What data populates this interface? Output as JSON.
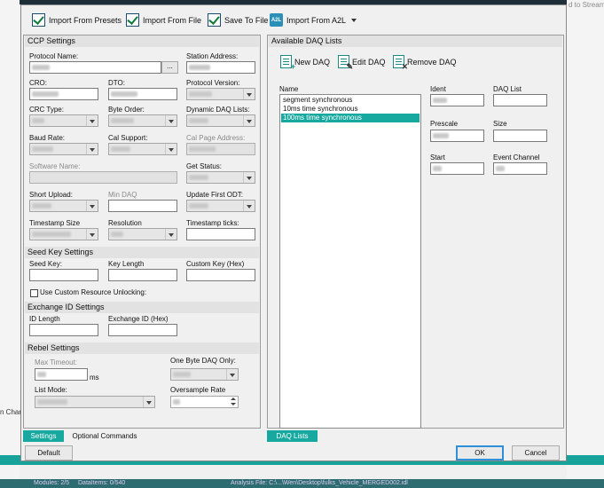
{
  "background": {
    "stream_text": "d to Stream",
    "channel_text": "n Chan",
    "status_modules": "Modules: 2/5",
    "status_dataitems": "DataItems: 0/540",
    "status_analysis": "Analysis File: C:\\...\\Wen\\Desktop\\fulks_Vehicle_MERGED002.idl"
  },
  "toolbar": {
    "import_presets": "Import From Presets",
    "import_file": "Import From File",
    "save_file": "Save To File",
    "a2l_icon_text": "A2L",
    "import_a2l": "Import From A2L"
  },
  "ccp": {
    "title": "CCP Settings",
    "protocol_name": "Protocol Name:",
    "ellipsis": "...",
    "station_address": "Station Address:",
    "cro": "CRO:",
    "dto": "DTO:",
    "protocol_version": "Protocol Version:",
    "crc_type": "CRC Type:",
    "byte_order": "Byte Order:",
    "dynamic_daq_lists": "Dynamic DAQ Lists:",
    "baud_rate": "Baud Rate:",
    "cal_support": "Cal Support:",
    "cal_page_address": "Cal Page Address:",
    "software_name": "Software Name:",
    "get_status": "Get Status:",
    "short_upload": "Short Upload:",
    "min_daq": "Min DAQ",
    "update_first_odt": "Update First ODT:",
    "timestamp_size": "Timestamp Size",
    "resolution": "Resolution",
    "timestamp_ticks": "Timestamp ticks:"
  },
  "seed": {
    "title": "Seed Key Settings",
    "seed_key": "Seed Key:",
    "key_length": "Key Length",
    "custom_key": "Custom Key (Hex)",
    "custom_unlock": "Use Custom Resource Unlocking:"
  },
  "exchange": {
    "title": "Exchange ID Settings",
    "id_length": "ID Length",
    "exchange_id": "Exchange ID (Hex)"
  },
  "rebel": {
    "title": "Rebel Settings",
    "max_timeout": "Max Timeout:",
    "ms": "ms",
    "one_byte_daq": "One Byte DAQ Only:",
    "list_mode": "List Mode:",
    "oversample_rate": "Oversample Rate"
  },
  "daq": {
    "title": "Available DAQ Lists",
    "new_daq": "New DAQ",
    "edit_daq": "Edit DAQ",
    "remove_daq": "Remove DAQ",
    "name_header": "Name",
    "items": [
      "segment synchronous",
      "10ms time synchronous",
      "100ms time synchronous"
    ],
    "selected_index": 2,
    "ident": "Ident",
    "daq_list": "DAQ List",
    "prescale": "Prescale",
    "size": "Size",
    "start": "Start",
    "event_channel": "Event Channel"
  },
  "tabs": {
    "settings": "Settings",
    "optional": "Optional Commands",
    "daq_lists": "DAQ Lists"
  },
  "buttons": {
    "default": "Default",
    "ok": "OK",
    "cancel": "Cancel"
  },
  "colors": {
    "accent": "#17a89f",
    "status_bar": "#2d6d72",
    "title_bar": "#1f2f3a"
  }
}
